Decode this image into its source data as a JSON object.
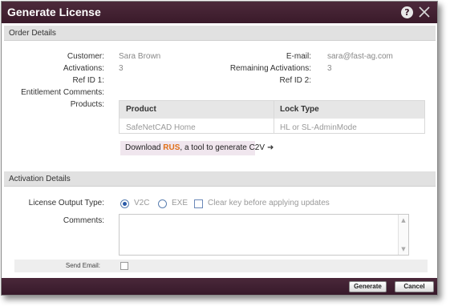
{
  "dialog": {
    "title": "Generate License",
    "help_glyph": "?"
  },
  "order_details": {
    "header": "Order Details",
    "customer_label": "Customer:",
    "customer_value": "Sara Brown",
    "email_label": "E-mail:",
    "email_value": "sara@fast-ag.com",
    "activations_label": "Activations:",
    "activations_value": "3",
    "remaining_label": "Remaining Activations:",
    "remaining_value": "3",
    "ref1_label": "Ref ID 1:",
    "ref2_label": "Ref ID 2:",
    "entitlement_label": "Entitlement Comments:",
    "products_label": "Products:",
    "products_table": {
      "columns": [
        "Product",
        "Lock Type"
      ],
      "rows": [
        [
          "SafeNetCAD Home",
          "HL or SL-AdminMode"
        ]
      ]
    },
    "download": {
      "prefix": "Download ",
      "highlight": "RUS",
      "suffix": ", a tool to generate C2V",
      "arrow": "➜"
    }
  },
  "activation_details": {
    "header": "Activation Details",
    "output_type_label": "License Output Type:",
    "options": [
      {
        "label": "V2C",
        "checked": true
      },
      {
        "label": "EXE",
        "checked": false
      }
    ],
    "clear_key_label": "Clear key before applying updates",
    "clear_key_checked": false,
    "comments_label": "Comments:",
    "comments_value": "",
    "send_email_label": "Send Email:",
    "send_email_checked": false
  },
  "footer": {
    "generate_label": "Generate",
    "cancel_label": "Cancel"
  },
  "colors": {
    "titlebar": "#3a1a2a",
    "section_header": "#e1e1e1",
    "rus_accent": "#e07018"
  }
}
